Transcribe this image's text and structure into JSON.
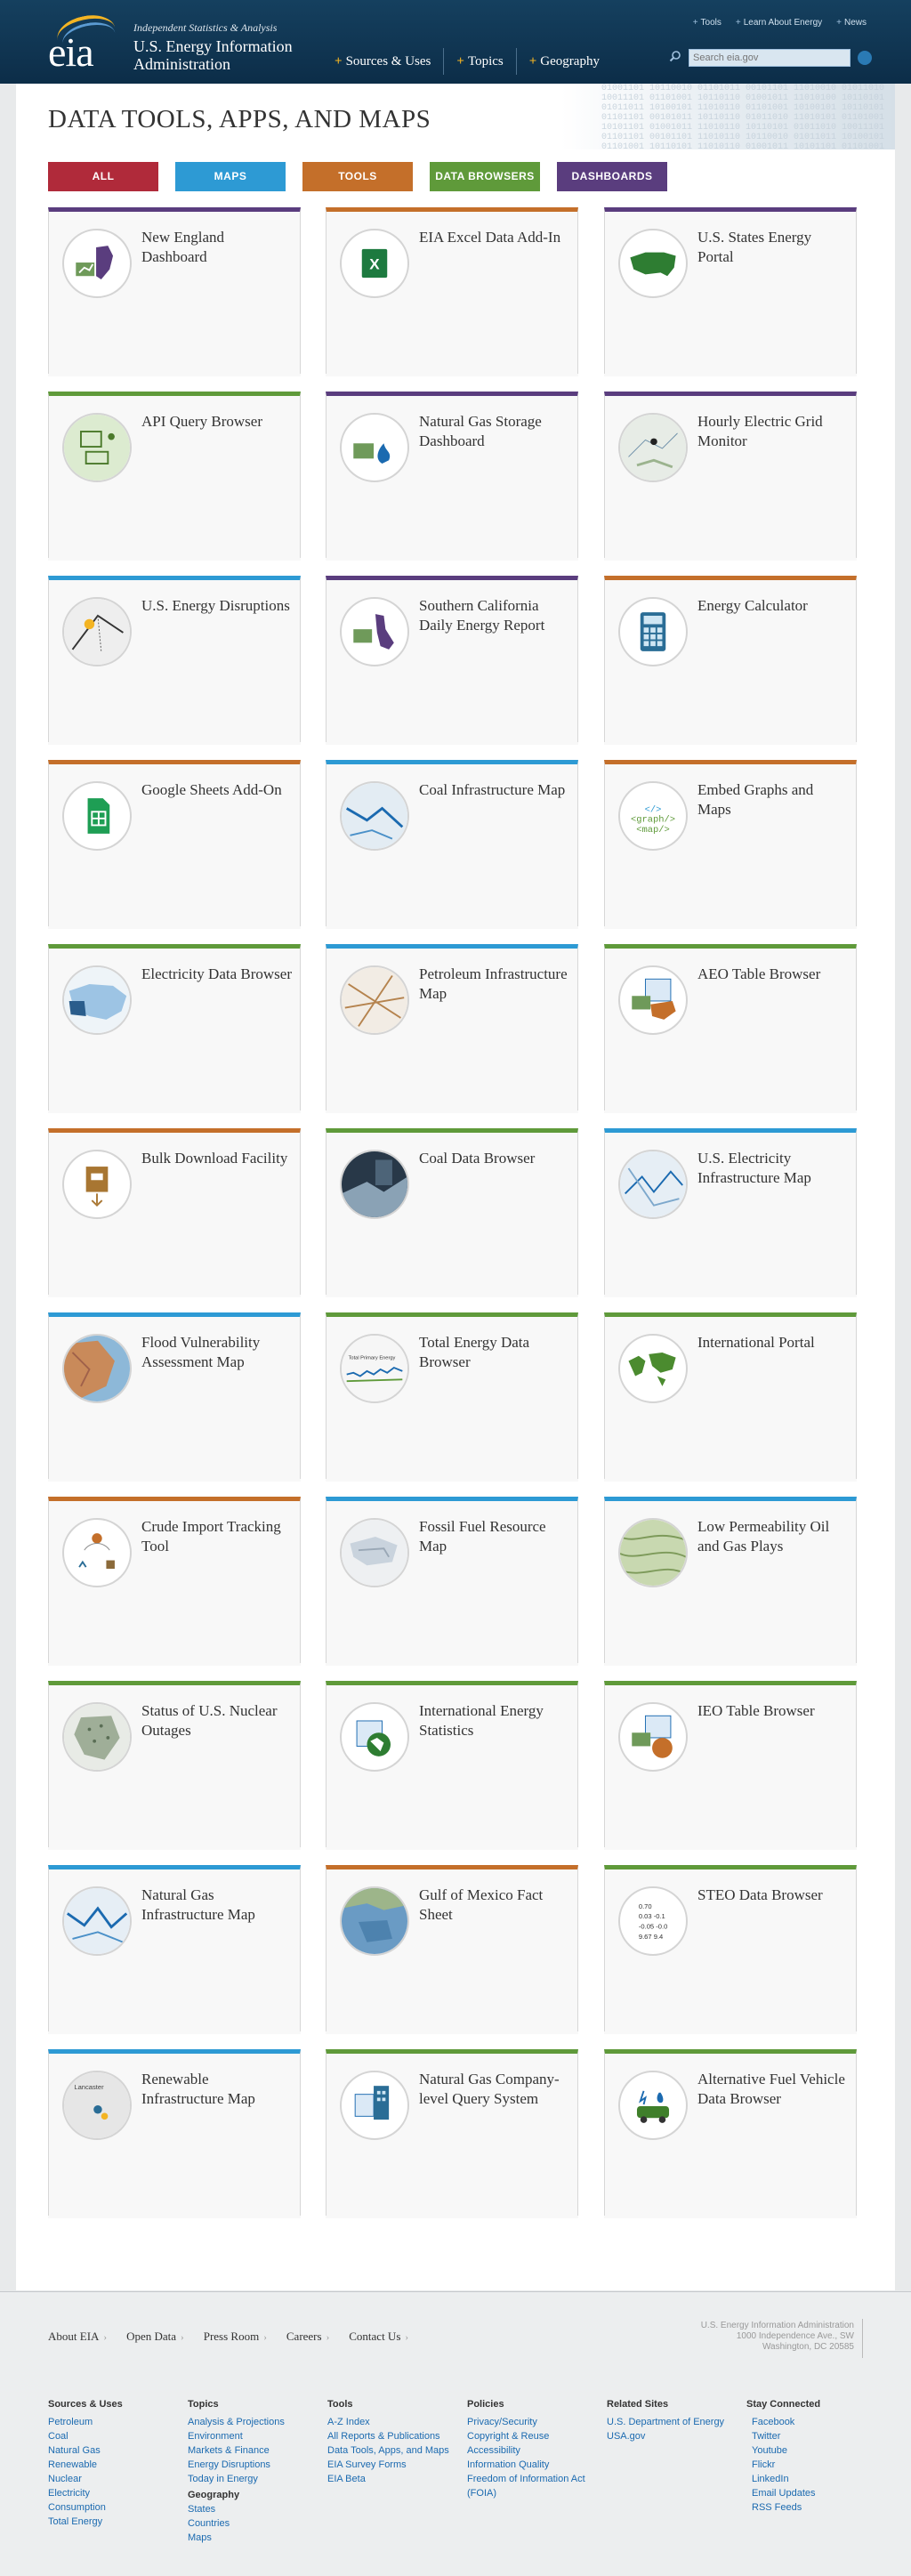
{
  "header": {
    "logo_text": "eia",
    "tagline": "Independent Statistics & Analysis",
    "agency": "U.S. Energy Information Administration",
    "top_links": [
      "Tools",
      "Learn About Energy",
      "News"
    ],
    "nav": [
      "Sources & Uses",
      "Topics",
      "Geography"
    ],
    "search_placeholder": "Search eia.gov"
  },
  "page": {
    "title": "DATA TOOLS, APPS, AND MAPS",
    "filters": [
      {
        "label": "ALL",
        "color": "#b02a3a"
      },
      {
        "label": "MAPS",
        "color": "#2d9ad4"
      },
      {
        "label": "TOOLS",
        "color": "#c46f2a"
      },
      {
        "label": "DATA BROWSERS",
        "color": "#5f9a3a"
      },
      {
        "label": "DASHBOARDS",
        "color": "#5a3d7e"
      }
    ],
    "cards": [
      {
        "title": "New England Dashboard",
        "color": "#5a3d7e",
        "icon": "new-england-map-icon"
      },
      {
        "title": "EIA Excel Data Add-In",
        "color": "#c46f2a",
        "icon": "excel-icon"
      },
      {
        "title": "U.S. States Energy Portal",
        "color": "#5a3d7e",
        "icon": "us-map-icon"
      },
      {
        "title": "API Query Browser",
        "color": "#5f9a3a",
        "icon": "computer-network-icon"
      },
      {
        "title": "Natural Gas Storage Dashboard",
        "color": "#5a3d7e",
        "icon": "gas-flame-chart-icon"
      },
      {
        "title": "Hourly Electric Grid Monitor",
        "color": "#5a3d7e",
        "icon": "grid-map-icon"
      },
      {
        "title": "U.S. Energy Disruptions",
        "color": "#2d9ad4",
        "icon": "disruptions-map-icon"
      },
      {
        "title": "Southern California Daily Energy Report",
        "color": "#5a3d7e",
        "icon": "california-map-icon"
      },
      {
        "title": "Energy Calculator",
        "color": "#c46f2a",
        "icon": "calculator-icon"
      },
      {
        "title": "Google Sheets Add-On",
        "color": "#c46f2a",
        "icon": "google-sheets-icon"
      },
      {
        "title": "Coal Infrastructure Map",
        "color": "#2d9ad4",
        "icon": "coal-map-icon"
      },
      {
        "title": "Embed Graphs and Maps",
        "color": "#c46f2a",
        "icon": "embed-code-icon"
      },
      {
        "title": "Electricity Data Browser",
        "color": "#5f9a3a",
        "icon": "electricity-map-icon"
      },
      {
        "title": "Petroleum Infrastructure Map",
        "color": "#2d9ad4",
        "icon": "petroleum-map-icon"
      },
      {
        "title": "AEO Table Browser",
        "color": "#5f9a3a",
        "icon": "aeo-table-icon"
      },
      {
        "title": "Bulk Download Facility",
        "color": "#c46f2a",
        "icon": "download-icon"
      },
      {
        "title": "Coal Data Browser",
        "color": "#5f9a3a",
        "icon": "coal-photo-icon"
      },
      {
        "title": "U.S. Electricity Infrastructure Map",
        "color": "#2d9ad4",
        "icon": "electricity-infra-map-icon"
      },
      {
        "title": "Flood Vulnerability Assessment Map",
        "color": "#2d9ad4",
        "icon": "flood-map-icon"
      },
      {
        "title": "Total Energy Data Browser",
        "color": "#5f9a3a",
        "icon": "total-energy-chart-icon"
      },
      {
        "title": "International Portal",
        "color": "#5f9a3a",
        "icon": "world-map-icon"
      },
      {
        "title": "Crude Import Tracking Tool",
        "color": "#c46f2a",
        "icon": "crude-import-icon"
      },
      {
        "title": "Fossil Fuel Resource Map",
        "color": "#2d9ad4",
        "icon": "fossil-map-icon"
      },
      {
        "title": "Low Permeability Oil and Gas Plays",
        "color": "#2d9ad4",
        "icon": "terrain-map-icon"
      },
      {
        "title": "Status of U.S. Nuclear Outages",
        "color": "#5f9a3a",
        "icon": "nuclear-map-icon"
      },
      {
        "title": "International Energy Statistics",
        "color": "#5f9a3a",
        "icon": "globe-table-icon"
      },
      {
        "title": "IEO Table Browser",
        "color": "#5f9a3a",
        "icon": "ieo-table-icon"
      },
      {
        "title": "Natural Gas Infrastructure Map",
        "color": "#2d9ad4",
        "icon": "gas-infra-map-icon"
      },
      {
        "title": "Gulf of Mexico Fact Sheet",
        "color": "#c46f2a",
        "icon": "gulf-map-icon"
      },
      {
        "title": "STEO Data Browser",
        "color": "#5f9a3a",
        "icon": "steo-table-icon"
      },
      {
        "title": "Renewable Infrastructure Map",
        "color": "#2d9ad4",
        "icon": "renewable-map-icon"
      },
      {
        "title": "Natural Gas Company-level Query System",
        "color": "#5f9a3a",
        "icon": "building-table-icon"
      },
      {
        "title": "Alternative Fuel Vehicle Data Browser",
        "color": "#5f9a3a",
        "icon": "alt-fuel-car-icon"
      }
    ]
  },
  "footer": {
    "nav": [
      "About EIA",
      "Open Data",
      "Press Room",
      "Careers",
      "Contact Us"
    ],
    "address": [
      "U.S. Energy Information Administration",
      "1000 Independence Ave., SW",
      "Washington, DC 20585"
    ],
    "columns": [
      {
        "heading": "Sources & Uses",
        "links": [
          "Petroleum",
          "Coal",
          "Natural Gas",
          "Renewable",
          "Nuclear",
          "Electricity",
          "Consumption",
          "Total Energy"
        ]
      },
      {
        "heading": "Topics",
        "links": [
          "Analysis & Projections",
          "Environment",
          "Markets & Finance",
          "Energy Disruptions",
          "Today in Energy"
        ],
        "sub": "Geography",
        "sub_links": [
          "States",
          "Countries",
          "Maps"
        ]
      },
      {
        "heading": "Tools",
        "links": [
          "A-Z Index",
          "All Reports & Publications",
          "Data Tools, Apps, and Maps",
          "EIA Survey Forms",
          "EIA Beta"
        ]
      },
      {
        "heading": "Policies",
        "links": [
          "Privacy/Security",
          "Copyright & Reuse",
          "Accessibility",
          "Information Quality",
          "Freedom of Information Act (FOIA)"
        ]
      },
      {
        "heading": "Related Sites",
        "links": [
          "U.S. Department of Energy",
          "USA.gov"
        ]
      },
      {
        "heading": "Stay Connected",
        "links": [
          "Facebook",
          "Twitter",
          "Youtube",
          "Flickr",
          "LinkedIn",
          "Email Updates",
          "RSS Feeds"
        ]
      }
    ]
  }
}
